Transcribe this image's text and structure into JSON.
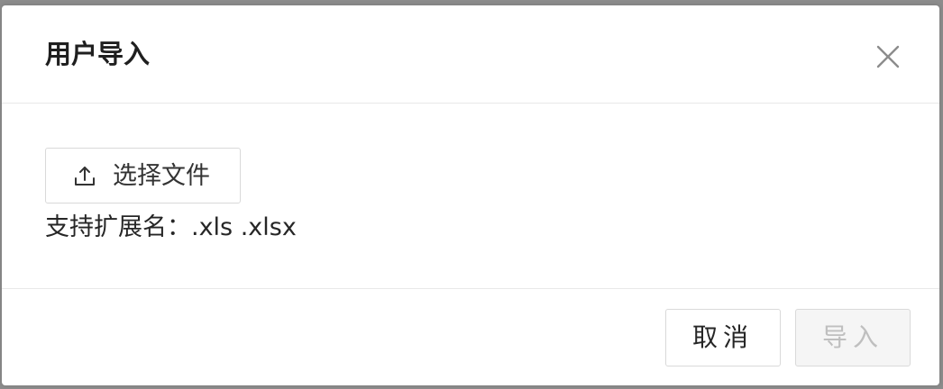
{
  "dialog": {
    "title": "用户导入",
    "upload_button_label": "选择文件",
    "hint": "支持扩展名：.xls .xlsx",
    "cancel_label": "取消",
    "import_label": "导入",
    "import_disabled": true
  },
  "icons": {
    "close": "close-icon",
    "upload": "upload-icon"
  },
  "colors": {
    "overlay": "#8c8c8c",
    "border": "#d9d9d9",
    "disabled_bg": "#f5f5f5",
    "disabled_text": "#bfbfbf"
  }
}
